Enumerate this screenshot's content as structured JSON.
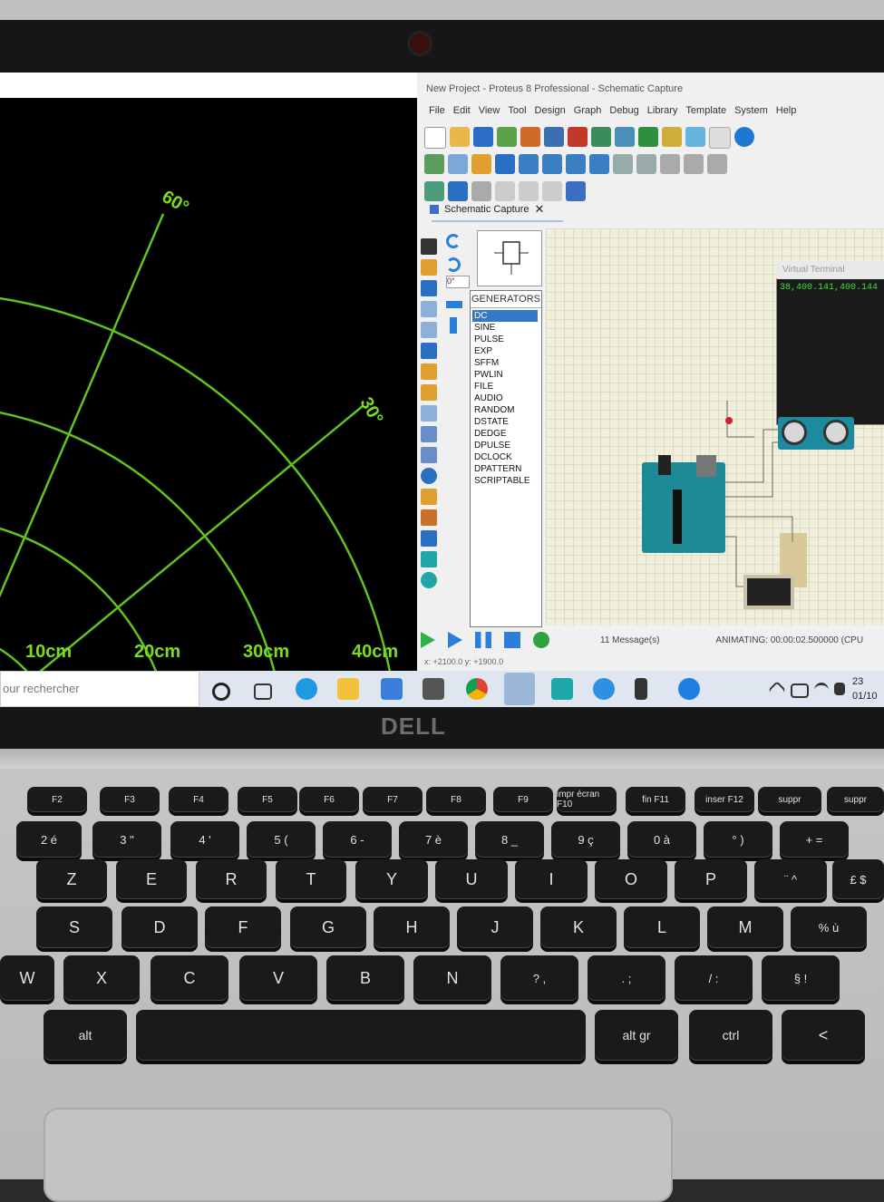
{
  "radar": {
    "angles": [
      "60°",
      "30°"
    ],
    "ranges": [
      "10cm",
      "20cm",
      "30cm",
      "40cm"
    ],
    "color": "#7bdc1e"
  },
  "proteus": {
    "window_title": "New Project - Proteus 8 Professional - Schematic Capture",
    "menu": [
      "File",
      "Edit",
      "View",
      "Tool",
      "Design",
      "Graph",
      "Debug",
      "Library",
      "Template",
      "System",
      "Help"
    ],
    "tab_label": "Schematic Capture",
    "rotation_value": "0°",
    "generators_header": "GENERATORS",
    "generators": [
      "DC",
      "SINE",
      "PULSE",
      "EXP",
      "SFFM",
      "PWLIN",
      "FILE",
      "AUDIO",
      "RANDOM",
      "DSTATE",
      "DEDGE",
      "DPULSE",
      "DCLOCK",
      "DPATTERN",
      "SCRIPTABLE"
    ],
    "selected_generator": "DC",
    "virtual_terminal_title": "Virtual Terminal",
    "virtual_terminal_text": "38,400.141,400.144",
    "messages": "11 Message(s)",
    "status": "ANIMATING: 00:00:02.500000 (CPU",
    "coords": "x: +2100.0  y: +1900.0"
  },
  "taskbar": {
    "search_placeholder": "our rechercher",
    "clock_time": "23",
    "clock_date": "01/10"
  },
  "laptop": {
    "brand": "DELL"
  },
  "keyboard": {
    "fn_row": [
      "F2",
      "F3",
      "F4",
      "F5",
      "F6",
      "F7",
      "F8",
      "F9",
      "impr écran F10",
      "fin F11",
      "inser F12",
      "suppr"
    ],
    "num_row": [
      "2 é",
      "3 \"",
      "4 '",
      "5 (",
      "6 -",
      "7 è",
      "8 _",
      "9 ç",
      "0 à",
      "° )",
      "+ ="
    ],
    "row_a": [
      "Z",
      "E",
      "R",
      "T",
      "Y",
      "U",
      "I",
      "O",
      "P",
      "¨ ^",
      "£ $"
    ],
    "row_q": [
      "S",
      "D",
      "F",
      "G",
      "H",
      "J",
      "K",
      "L",
      "M",
      "% ù"
    ],
    "row_w": [
      "W",
      "X",
      "C",
      "V",
      "B",
      "N",
      "? ,",
      ". ;",
      "/ :",
      "§ !"
    ],
    "row_bottom": [
      "alt",
      "",
      "alt gr",
      "ctrl",
      "<"
    ]
  }
}
